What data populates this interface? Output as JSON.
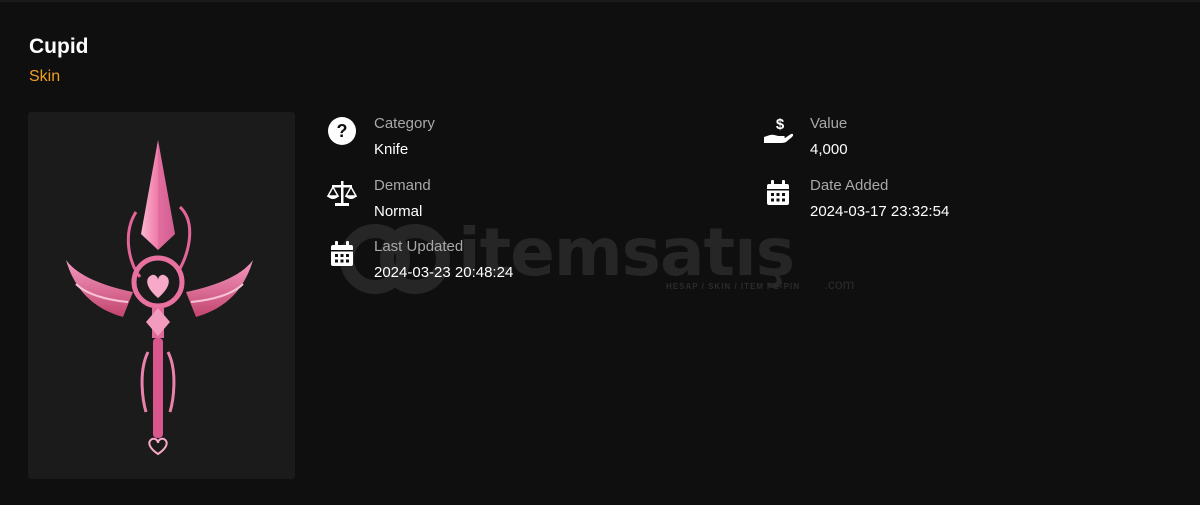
{
  "item": {
    "name": "Cupid",
    "type": "Skin"
  },
  "details": {
    "category": {
      "label": "Category",
      "value": "Knife",
      "icon": "question-circle-icon"
    },
    "demand": {
      "label": "Demand",
      "value": "Normal",
      "icon": "scale-icon"
    },
    "last_updated": {
      "label": "Last Updated",
      "value": "2024-03-23 20:48:24",
      "icon": "calendar-icon"
    },
    "value": {
      "label": "Value",
      "value": "4,000",
      "icon": "hand-dollar-icon"
    },
    "date_added": {
      "label": "Date Added",
      "value": "2024-03-17 23:32:54",
      "icon": "calendar-icon"
    }
  },
  "watermark": {
    "brand": "itemsatış",
    "tagline": "HESAP / SKIN / ITEM / E-PIN",
    "domain": ".com"
  },
  "colors": {
    "accent": "#f0a020",
    "background": "#0f0f0f",
    "panel": "#1b1b1b",
    "knife_pink": "#f08cb4"
  }
}
